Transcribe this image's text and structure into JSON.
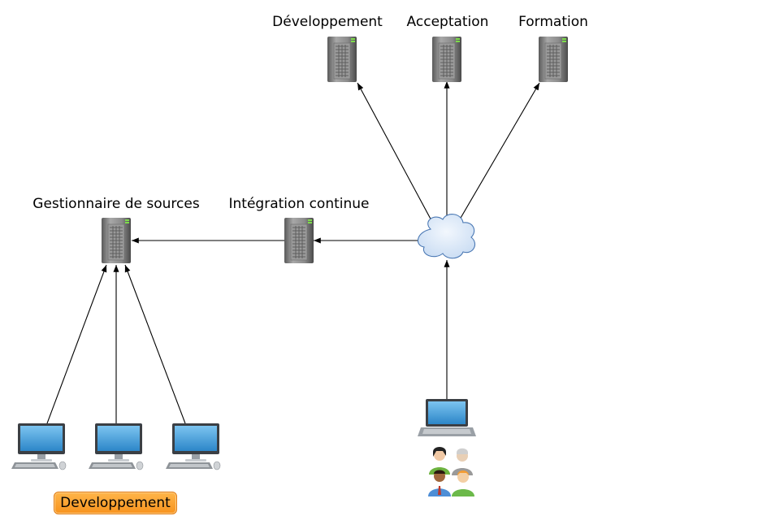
{
  "servers": {
    "dev": "Développement",
    "acceptance": "Acceptation",
    "training": "Formation",
    "source_control": "Gestionnaire de sources",
    "ci": "Intégration continue"
  },
  "badge": {
    "label": "Developpement"
  },
  "icons": {
    "server": "server-tower-icon",
    "cloud": "cloud-icon",
    "desktop": "desktop-computer-icon",
    "laptop": "laptop-icon",
    "users": "user-group-icon"
  },
  "colors": {
    "badge_fill": "#f7931e",
    "cloud_fill": "#d6e4f5",
    "screen_blue": "#3a9ad9"
  }
}
